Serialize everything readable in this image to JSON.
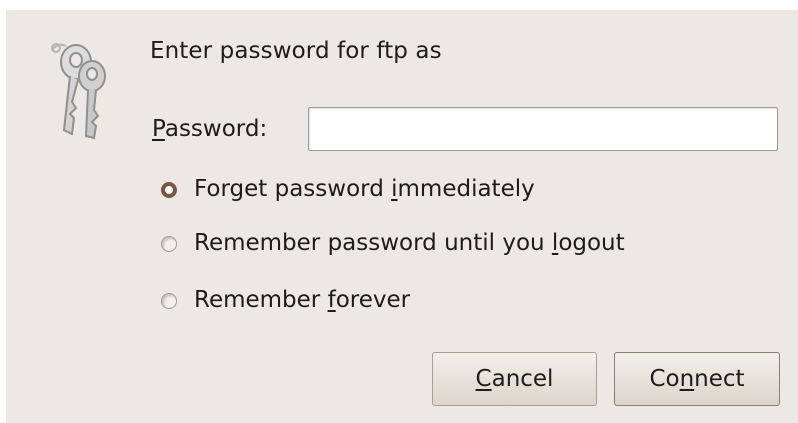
{
  "dialog": {
    "prompt": "Enter password for ftp as",
    "password": {
      "label_accel": "P",
      "label_rest": "assword:",
      "value": ""
    },
    "options": [
      {
        "pre": "Forget password ",
        "accel": "i",
        "post": "mmediately",
        "selected": true
      },
      {
        "pre": "Remember password until you ",
        "accel": "l",
        "post": "ogout",
        "selected": false
      },
      {
        "pre": "Remember ",
        "accel": "f",
        "post": "orever",
        "selected": false
      }
    ],
    "buttons": {
      "cancel": {
        "accel": "C",
        "rest": "ancel"
      },
      "connect": {
        "pre": "Co",
        "accel": "n",
        "post": "nect"
      }
    }
  },
  "icons": {
    "dialog_icon": "keys-icon",
    "radio": "radio-button"
  },
  "colors": {
    "background": "#ede8e4",
    "radio_selected": "#7a5641"
  }
}
